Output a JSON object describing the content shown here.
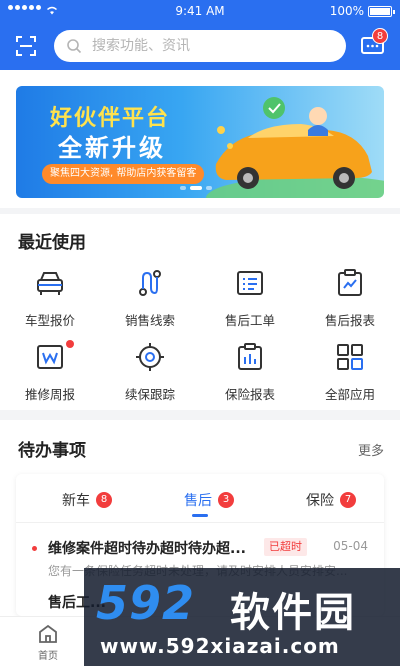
{
  "status_bar": {
    "time": "9:41 AM",
    "battery": "100%"
  },
  "header": {
    "search_placeholder": "搜索功能、资讯",
    "message_badge": "8"
  },
  "banner": {
    "title_line1": "好伙伴平台",
    "title_line2": "全新升级",
    "subtitle": "聚焦四大资源, 帮助店内获客留客"
  },
  "recent": {
    "title": "最近使用",
    "items": [
      {
        "label": "车型报价",
        "icon": "car-icon"
      },
      {
        "label": "销售线索",
        "icon": "route-icon"
      },
      {
        "label": "售后工单",
        "icon": "list-icon"
      },
      {
        "label": "售后报表",
        "icon": "trend-report-icon"
      },
      {
        "label": "推修周报",
        "icon": "weekly-report-icon"
      },
      {
        "label": "续保跟踪",
        "icon": "target-icon"
      },
      {
        "label": "保险报表",
        "icon": "bar-report-icon"
      },
      {
        "label": "全部应用",
        "icon": "apps-icon"
      }
    ]
  },
  "todo": {
    "title": "待办事项",
    "more": "更多",
    "tabs": [
      {
        "label": "新车",
        "count": "8"
      },
      {
        "label": "售后",
        "count": "3"
      },
      {
        "label": "保险",
        "count": "7"
      }
    ],
    "items": [
      {
        "title": "维修案件超时待办超时待办超...",
        "tag": "已超时",
        "date": "05-04",
        "desc": "您有一条保险任务超时未处理，请及时安排人员安排安..."
      },
      {
        "title": "售后工..."
      }
    ]
  },
  "tabbar": {
    "home_label": "首页"
  },
  "watermark": {
    "big": "592",
    "cn": "软件园",
    "url": "www.592xiazai.com"
  },
  "colors": {
    "primary": "#2a6ff0",
    "badge": "#f23d3d"
  }
}
